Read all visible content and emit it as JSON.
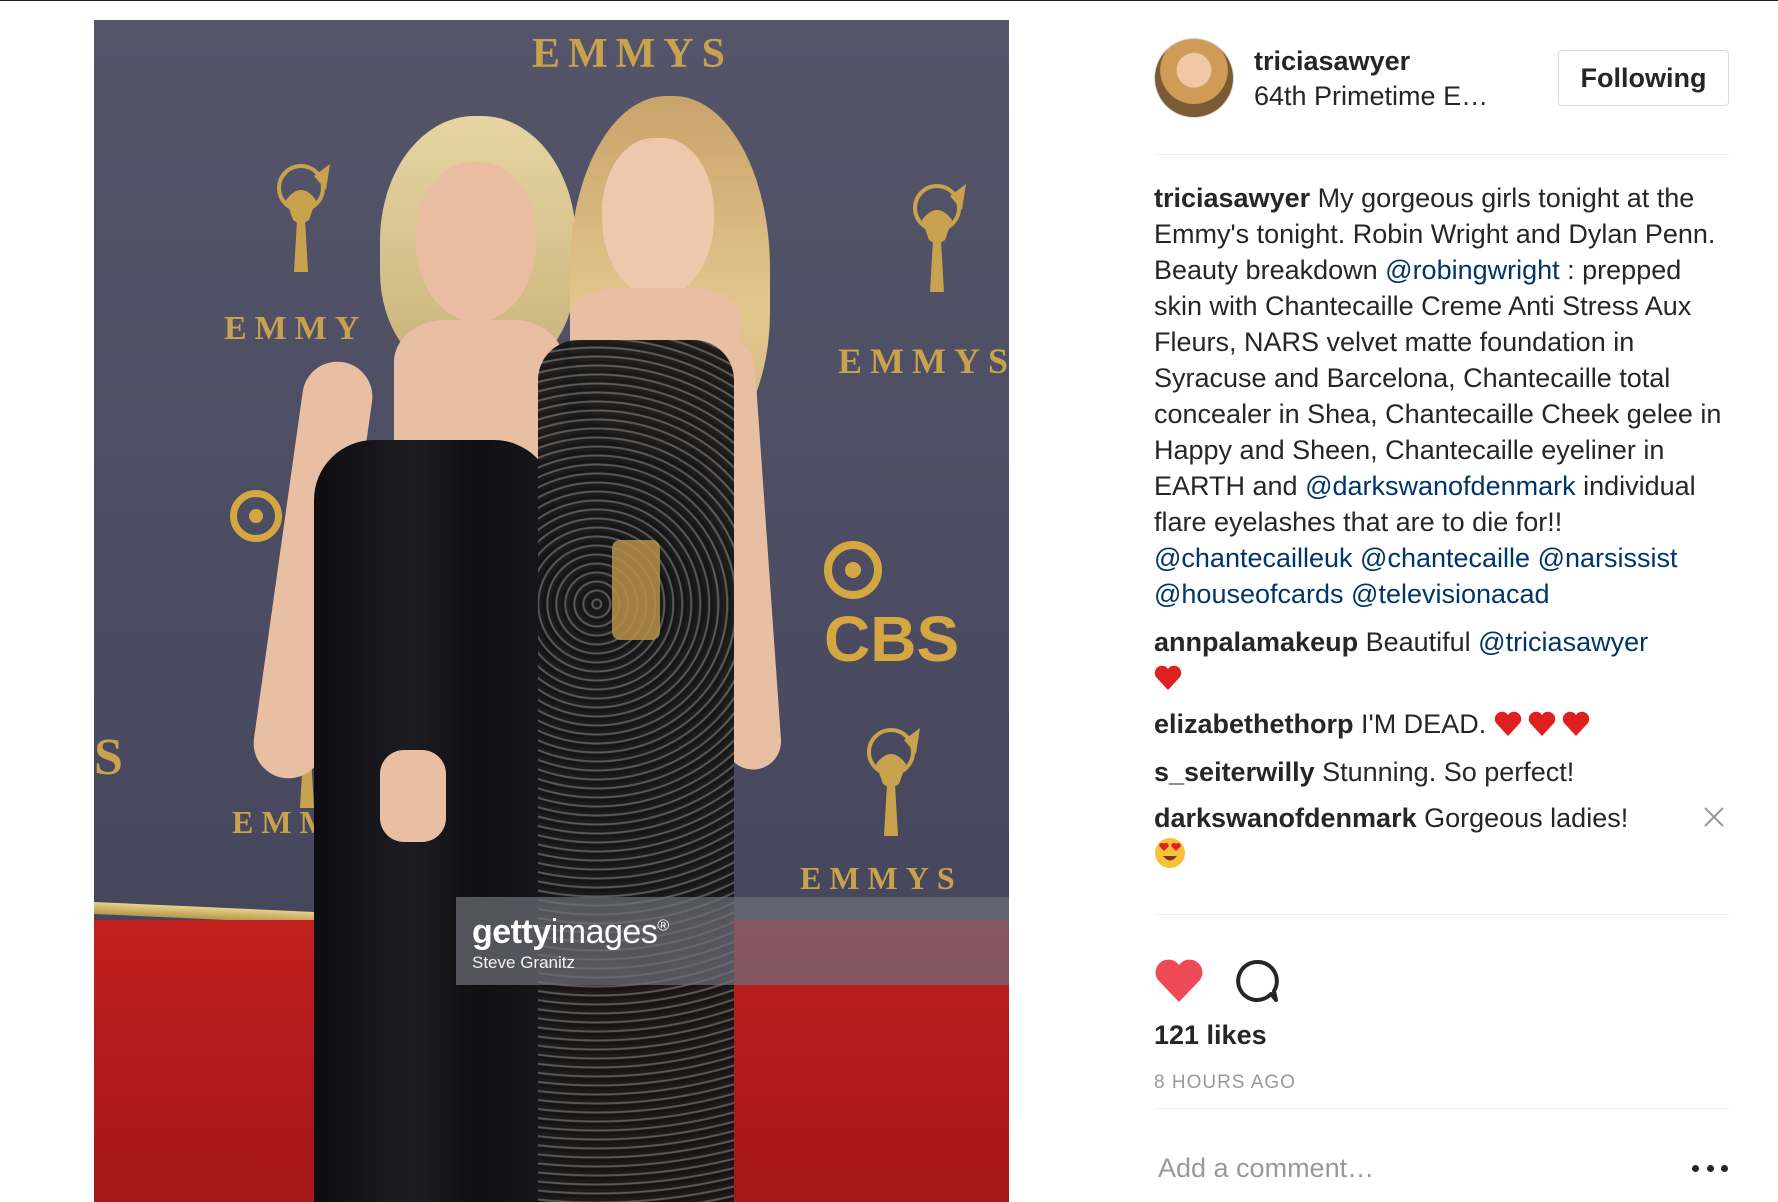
{
  "post": {
    "photo": {
      "alt_logo_top": "EMMYS",
      "backdrop_emmy_left": "EMMY",
      "backdrop_emmy_right": "EMMYS",
      "backdrop_emmy_bottom_left": "EMM",
      "backdrop_emmy_bottom_right": "EMMYS",
      "backdrop_cbs": "CBS",
      "watermark_brand_bold": "getty",
      "watermark_brand_light": "images",
      "watermark_reg": "®",
      "watermark_credit": "Steve Granitz"
    },
    "header": {
      "username": "triciasawyer",
      "location": "64th Primetime E…",
      "follow_label": "Following"
    },
    "caption": {
      "username": "triciasawyer",
      "text_1": " My gorgeous girls tonight at the Emmy's tonight. Robin Wright and Dylan Penn. Beauty breakdown ",
      "mention_1": "@robingwright",
      "text_2": " : prepped skin with Chantecaille Creme Anti Stress Aux Fleurs, NARS velvet matte foundation in Syracuse and Barcelona, Chantecaille total concealer in Shea, Chantecaille Cheek gelee in Happy and Sheen, Chantecaille eyeliner in EARTH and ",
      "mention_2": "@darkswanofdenmark",
      "text_3": " individual flare eyelashes that are to die for!! ",
      "mention_3": "@chantecailleuk",
      "mention_4": "@chantecaille",
      "mention_5": "@narsissist",
      "mention_6": "@houseofcards",
      "mention_7": "@televisionacad"
    },
    "comments": [
      {
        "username": "annpalamakeup",
        "text": " Beautiful ",
        "mention": "@triciasawyer",
        "emoji": "red-heart"
      },
      {
        "username": "elizabethethorp",
        "text": " I'M DEAD. ",
        "emoji": "red-heart x3"
      },
      {
        "username": "s_seiterwilly",
        "text": " Stunning. So perfect!"
      },
      {
        "username": "darkswanofdenmark",
        "text": " Gorgeous ladies!",
        "emoji": "heart-eyes-face"
      }
    ],
    "actions": {
      "like_icon": "heart-filled-icon",
      "comment_icon": "speech-bubble-icon",
      "like_color": "#ed4956"
    },
    "likes": "121 likes",
    "timestamp": "8 HOURS AGO",
    "add_comment_placeholder": "Add a comment…",
    "more_icon": "ellipsis-icon"
  }
}
